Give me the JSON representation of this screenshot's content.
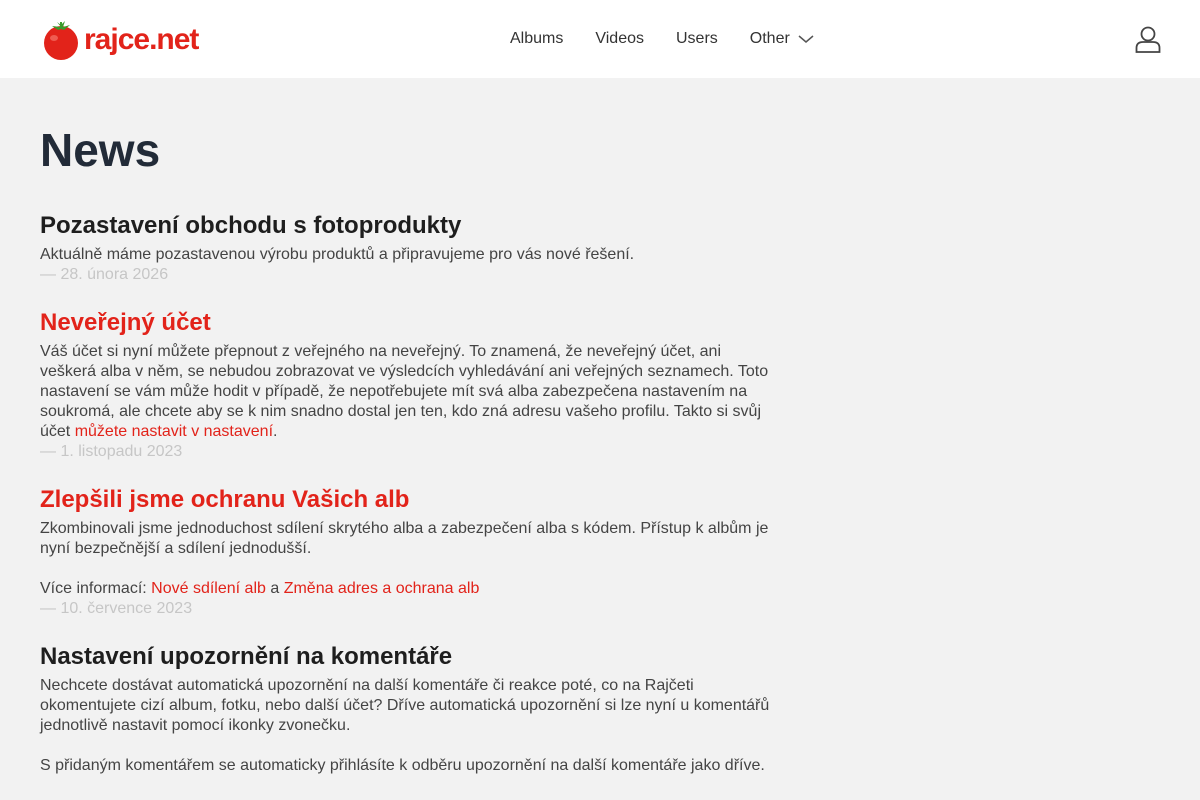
{
  "header": {
    "logo_text": "rajce.net",
    "nav": [
      {
        "label": "Albums"
      },
      {
        "label": "Videos"
      },
      {
        "label": "Users"
      },
      {
        "label": "Other"
      }
    ],
    "user_icon": "user-icon"
  },
  "page": {
    "title": "News"
  },
  "news": [
    {
      "title": "Pozastavení obchodu s fotoprodukty",
      "text": "Aktuálně máme pozastavenou výrobu produktů a připravujeme pro vás nové řešení.",
      "date": "— 28. února 2026"
    },
    {
      "title": "Neveřejný účet",
      "text": "Váš účet si nyní můžete přepnout z veřejného na neveřejný. To znamená, že neveřejný účet, ani veškerá alba v něm, se nebudou zobrazovat ve výsledcích vyhledávání ani veřejných seznamech. Toto nastavení se vám může hodit v případě, že nepotřebujete mít svá alba zabezpečena nastavením na soukromá, ale chcete aby se k nim snadno dostal jen ten, kdo zná adresu vašeho profilu. Takto si svůj účet ",
      "link": "můžete nastavit v nastavení",
      "text_end": ".",
      "date": "— 1. listopadu 2023"
    },
    {
      "title": "Zlepšili jsme ochranu Vašich alb",
      "text": "Zkombinovali jsme jednoduchost sdílení skrytého alba a zabezpečení alba s kódem. Přístup k albům je nyní bezpečnější a sdílení jednodušší.",
      "more_prefix": "Více informací: ",
      "link1": "Nové sdílení alb",
      "conj": " a ",
      "link2": "Změna adres a ochrana alb",
      "date": "— 10. července 2023"
    },
    {
      "title": "Nastavení upozornění na komentáře",
      "text": "Nechcete dostávat automatická upozornění na další komentáře či reakce poté, co na Rajčeti okomentujete cizí album, fotku, nebo další účet? Dříve automatická upozornění si lze nyní u komentářů jednotlivě nastavit pomocí ikonky zvonečku.",
      "text2": "S přidaným komentářem se automaticky přihlásíte k odběru upozornění na další komentáře jako dříve."
    }
  ],
  "colors": {
    "accent": "#e2231a",
    "background": "#f2f2f2",
    "header": "#ffffff"
  }
}
